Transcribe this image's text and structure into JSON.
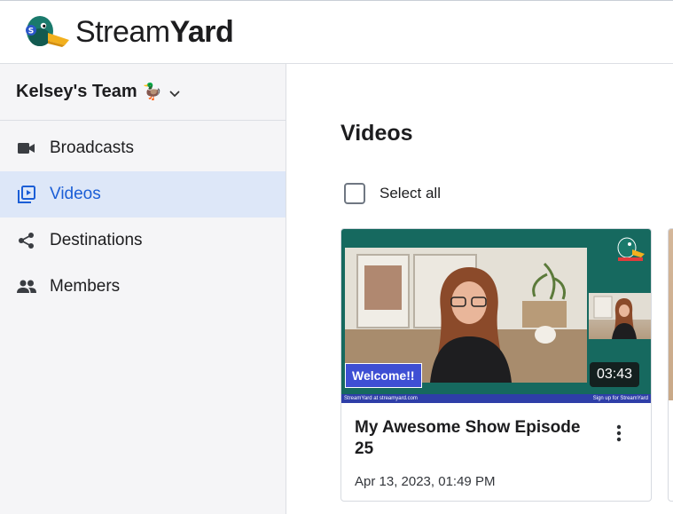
{
  "app": {
    "logo_text_light": "Stream",
    "logo_text_bold": "Yard",
    "logo_icon": "duck-logo-icon"
  },
  "sidebar": {
    "team_name": "Kelsey's Team",
    "team_emoji": "🦆",
    "team_dropdown_icon": "chevron-down-icon",
    "items": [
      {
        "label": "Broadcasts",
        "icon": "video-camera-icon",
        "active": false
      },
      {
        "label": "Videos",
        "icon": "video-library-icon",
        "active": true
      },
      {
        "label": "Destinations",
        "icon": "share-icon",
        "active": false
      },
      {
        "label": "Members",
        "icon": "people-icon",
        "active": false
      }
    ]
  },
  "main": {
    "title": "Videos",
    "select_all_label": "Select all",
    "videos": [
      {
        "title": "My Awesome Show Episode 25",
        "date": "Apr 13, 2023, 01:49 PM",
        "duration": "03:43",
        "overlay_banner": "Welcome!!",
        "footer_left": "StreamYard at streamyard.com",
        "footer_right": "Sign up for StreamYard"
      }
    ]
  },
  "colors": {
    "accent": "#1b5ed6",
    "active_nav_bg": "#dde7f8",
    "sidebar_bg": "#f5f5f7",
    "thumbnail_bg": "#16695f",
    "banner_blue": "#3e4fd4"
  }
}
